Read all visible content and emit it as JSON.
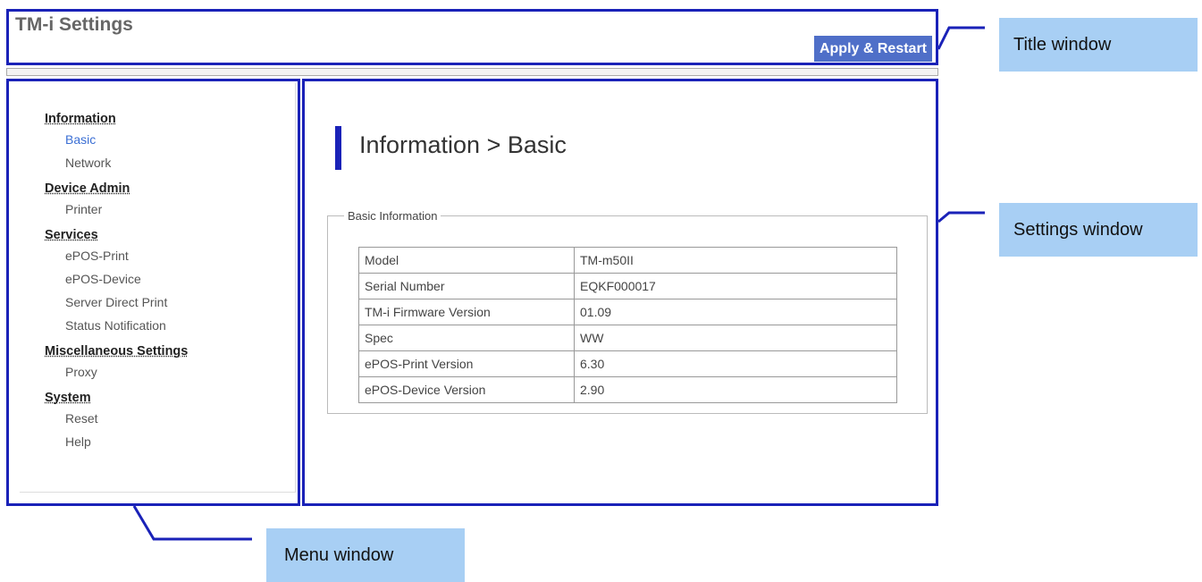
{
  "title_bar": {
    "app_title": "TM-i Settings",
    "apply_button": "Apply & Restart"
  },
  "menu": {
    "sections": [
      {
        "heading": "Information",
        "items": [
          "Basic",
          "Network"
        ]
      },
      {
        "heading": "Device Admin",
        "items": [
          "Printer"
        ]
      },
      {
        "heading": "Services",
        "items": [
          "ePOS-Print",
          "ePOS-Device",
          "Server Direct Print",
          "Status Notification"
        ]
      },
      {
        "heading": "Miscellaneous Settings",
        "items": [
          "Proxy"
        ]
      },
      {
        "heading": "System",
        "items": [
          "Reset",
          "Help"
        ]
      }
    ],
    "active_item": "Basic"
  },
  "settings": {
    "page_title": "Information > Basic",
    "group_legend": "Basic Information",
    "rows": [
      {
        "label": "Model",
        "value": "TM-m50II"
      },
      {
        "label": "Serial Number",
        "value": "EQKF000017"
      },
      {
        "label": "TM-i Firmware Version",
        "value": "01.09"
      },
      {
        "label": "Spec",
        "value": "WW"
      },
      {
        "label": "ePOS-Print Version",
        "value": "6.30"
      },
      {
        "label": "ePOS-Device Version",
        "value": "2.90"
      }
    ]
  },
  "callouts": {
    "title_window": "Title window",
    "settings_window": "Settings window",
    "menu_window": "Menu window"
  },
  "colors": {
    "frame_outline": "#1a22b8",
    "apply_button_bg": "#4f6fc8",
    "callout_bg": "#a8cff4",
    "active_link": "#3b6fd4"
  }
}
